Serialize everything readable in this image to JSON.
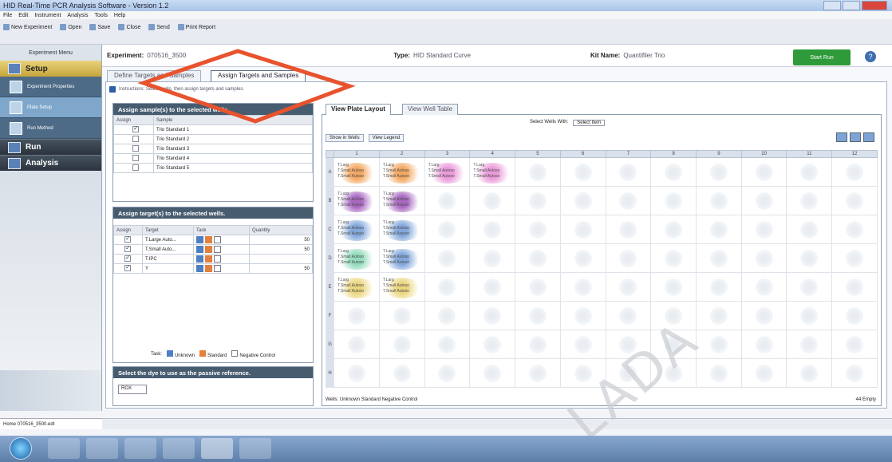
{
  "window": {
    "title": "HID Real-Time PCR Analysis Software - Version 1.2"
  },
  "menu": [
    "File",
    "Edit",
    "Instrument",
    "Analysis",
    "Tools",
    "Help"
  ],
  "toolbar": [
    "New Experiment",
    "Open",
    "Save",
    "Close",
    "Send",
    "Print Report"
  ],
  "experiment": {
    "label": "Experiment:",
    "name": "070516_3500",
    "type_label": "Type:",
    "type": "HID Standard Curve",
    "kit_label": "Kit Name:",
    "kit": "Quantifiler Trio",
    "start_run": "Start Run"
  },
  "sidebar": {
    "header": "Experiment Menu",
    "setup": "Setup",
    "sub_items": [
      "Experiment Properties",
      "Plate Setup",
      "Run Method"
    ],
    "run": "Run",
    "analysis": "Analysis",
    "foot": "Home   070516_3500.edt"
  },
  "tabs": [
    "Define Targets and Samples",
    "Assign Targets and Samples"
  ],
  "instructions": "Instructions: Select wells, then assign targets and samples.",
  "samples_panel": {
    "title": "Assign sample(s) to the selected wells.",
    "headers": [
      "Assign",
      "Sample"
    ],
    "rows": [
      {
        "checked": true,
        "name": "Trio Standard 1"
      },
      {
        "checked": false,
        "name": "Trio Standard 2"
      },
      {
        "checked": false,
        "name": "Trio Standard 3"
      },
      {
        "checked": false,
        "name": "Trio Standard 4"
      },
      {
        "checked": false,
        "name": "Trio Standard 5"
      }
    ]
  },
  "targets_panel": {
    "title": "Assign target(s) to the selected wells.",
    "headers": [
      "Assign",
      "Target",
      "Task",
      "Quantity"
    ],
    "rows": [
      {
        "checked": true,
        "target": "T.Large Auto...",
        "qty": "50"
      },
      {
        "checked": true,
        "target": "T.Small Auto...",
        "qty": "50"
      },
      {
        "checked": true,
        "target": "T.IPC",
        "qty": ""
      },
      {
        "checked": true,
        "target": "Y",
        "qty": "50"
      }
    ],
    "legend": [
      "Unknown",
      "Standard",
      "Negative Control"
    ],
    "legend_prefix": "Task:"
  },
  "reference_panel": {
    "title": "Select the dye to use as the passive reference.",
    "value": "ROX"
  },
  "plate": {
    "tabs": [
      "View Plate Layout",
      "View Well Table"
    ],
    "select_label": "Select Wells With:",
    "select_value": "Select Item",
    "show_in_wells": "Show in Wells",
    "view_legend": "View Legend",
    "columns": [
      "1",
      "2",
      "3",
      "4",
      "5",
      "6",
      "7",
      "8",
      "9",
      "10",
      "11",
      "12"
    ],
    "rows": [
      "A",
      "B",
      "C",
      "D",
      "E",
      "F",
      "G",
      "H"
    ],
    "well_text": "T.Larg\nT.Small Autoso\nT.Small Autoso",
    "colors": {
      "orange": "#f29a48",
      "purple": "#9b4fb8",
      "blue": "#6f9ad6",
      "pink": "#e88ad4",
      "green": "#7fd6b0",
      "yellow": "#e8d06a"
    },
    "footer": "Wells: Unknown  Standard  Negative Control",
    "empty": "44 Empty"
  },
  "annotation_color": "#e8532e",
  "watermark": "LADA"
}
